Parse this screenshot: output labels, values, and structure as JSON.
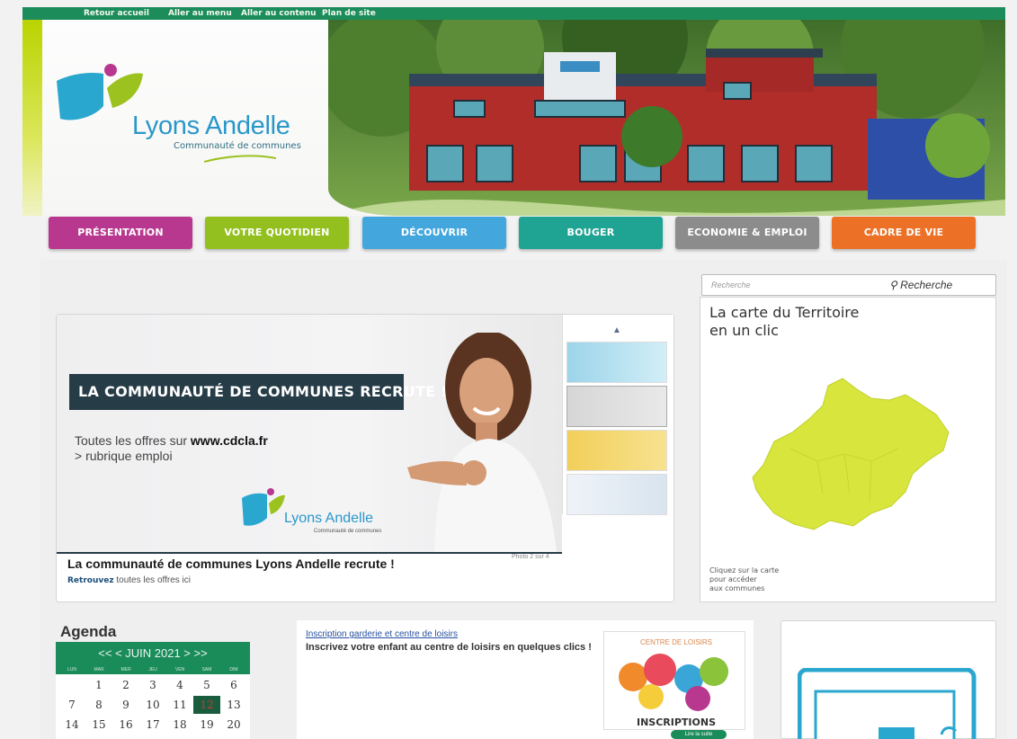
{
  "skip_links": [
    "Retour accueil",
    "Aller au menu",
    "Aller au contenu",
    "Plan de site"
  ],
  "logo": {
    "brand": "Lyons Andelle",
    "subtitle": "Communauté de communes"
  },
  "nav": [
    {
      "label": "PRÉSENTATION",
      "color": "#b9388f"
    },
    {
      "label": "VOTRE QUOTIDIEN",
      "color": "#93c01f"
    },
    {
      "label": "DÉCOUVRIR",
      "color": "#43a7de"
    },
    {
      "label": "BOUGER",
      "color": "#1fa393"
    },
    {
      "label": "ECONOMIE & EMPLOI",
      "color": "#8c8c8c"
    },
    {
      "label": "CADRE DE VIE",
      "color": "#ec7126"
    }
  ],
  "slider": {
    "banner": "LA COMMUNAUTÉ DE COMMUNES RECRUTE !",
    "offers_line1": "Toutes les offres sur",
    "offers_url": "www.cdcla.fr",
    "offers_line2": "> rubrique emploi",
    "logo_text": "Lyons Andelle",
    "logo_sub": "Communauté de communes",
    "title": "La communauté de communes Lyons Andelle recrute !",
    "sub_strong": "Retrouvez",
    "sub_text": "toutes les offres ici",
    "count": "Photo 2 sur 4"
  },
  "search": {
    "placeholder": "Recherche",
    "button": "Recherche"
  },
  "map": {
    "title": "La carte du Territoire\nen un clic",
    "note_lines": [
      "Cliquez sur la carte",
      "pour accéder",
      "aux communes"
    ]
  },
  "agenda": {
    "title": "Agenda",
    "header": "<< < JUIN 2021 > >>",
    "days": [
      "LUN",
      "MAR",
      "MER",
      "JEU",
      "VEN",
      "SAM",
      "DIM"
    ],
    "weeks": [
      [
        "",
        "1",
        "2",
        "3",
        "4",
        "5",
        "6"
      ],
      [
        "7",
        "8",
        "9",
        "10",
        "11",
        "12",
        "13"
      ],
      [
        "14",
        "15",
        "16",
        "17",
        "18",
        "19",
        "20"
      ]
    ],
    "today": "12"
  },
  "news": {
    "link": "Inscription garderie et centre de loisirs",
    "desc": "Inscrivez votre enfant au centre de loisirs en quelques clics !",
    "img_label_top": "CENTRE DE LOISIRS",
    "img_label_bottom": "INSCRIPTIONS",
    "more": "Lire la suite"
  }
}
